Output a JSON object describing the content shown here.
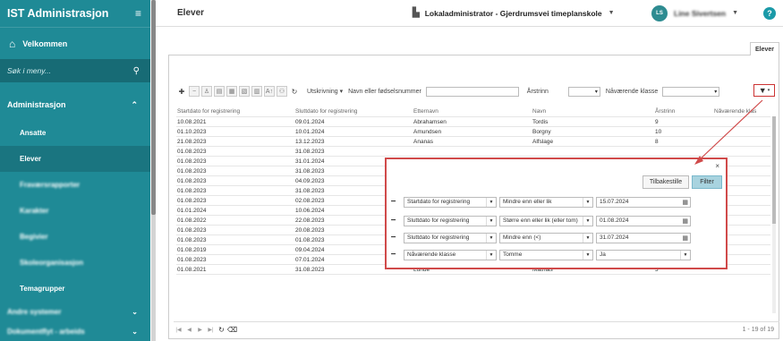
{
  "sidebar": {
    "app_title": "IST Administrasjon",
    "menu_toggle": "≡",
    "home_label": "Velkommen",
    "search_placeholder": "Søk i meny...",
    "section_label": "Administrasjon",
    "items": [
      {
        "label": "Ansatte",
        "active": false,
        "blurred": false
      },
      {
        "label": "Elever",
        "active": true,
        "blurred": false
      },
      {
        "label": "Fraværsrapporter",
        "active": false,
        "blurred": true
      },
      {
        "label": "Karakter",
        "active": false,
        "blurred": true
      },
      {
        "label": "Begivier",
        "active": false,
        "blurred": true
      },
      {
        "label": "Skoleorganisasjon",
        "active": false,
        "blurred": true
      },
      {
        "label": "Temagrupper",
        "active": false,
        "blurred": false
      }
    ],
    "bottom_items": [
      "Andre systemer",
      "Dokumentflyt - arbeids"
    ]
  },
  "topbar": {
    "page_title": "Elever",
    "org_label": "Lokaladministrator - Gjerdrumsvei timeplanskole",
    "user_initials": "LS",
    "user_name": "Line Sivertsen",
    "help_label": "?"
  },
  "tab_label": "Elever",
  "toolbar": {
    "utskrivning_label": "Utskrivning",
    "name_label": "Navn eller fødselsnummer",
    "year_label": "Årstrinn",
    "class_label": "Nåværende klasse"
  },
  "grid": {
    "columns": [
      "Startdato for registrering",
      "Sluttdato for registrering",
      "Etternavn",
      "Navn",
      "Årstrinn",
      "Nåværende klas"
    ],
    "rows": [
      [
        "10.08.2021",
        "09.01.2024",
        "Abrahamsen",
        "Tordis",
        "9",
        ""
      ],
      [
        "01.10.2023",
        "10.01.2024",
        "Amundsen",
        "Borgny",
        "10",
        ""
      ],
      [
        "21.08.2023",
        "13.12.2023",
        "Ananas",
        "Alfslage",
        "8",
        ""
      ],
      [
        "01.08.2023",
        "31.08.2023",
        "",
        "",
        "",
        ""
      ],
      [
        "01.08.2023",
        "31.01.2024",
        "",
        "",
        "",
        ""
      ],
      [
        "01.08.2023",
        "31.08.2023",
        "",
        "",
        "",
        ""
      ],
      [
        "01.08.2023",
        "04.09.2023",
        "",
        "",
        "",
        ""
      ],
      [
        "01.08.2023",
        "31.08.2023",
        "",
        "",
        "",
        ""
      ],
      [
        "01.08.2023",
        "02.08.2023",
        "",
        "",
        "",
        ""
      ],
      [
        "01.01.2024",
        "10.06.2024",
        "",
        "",
        "",
        ""
      ],
      [
        "01.08.2022",
        "22.08.2023",
        "",
        "",
        "",
        ""
      ],
      [
        "01.08.2023",
        "20.08.2023",
        "",
        "",
        "",
        ""
      ],
      [
        "01.08.2023",
        "01.08.2023",
        "Gebonsag",
        "Snadig",
        "7",
        ""
      ],
      [
        "01.08.2019",
        "09.04.2024",
        "Jensen",
        "Alfhild",
        "5",
        ""
      ],
      [
        "01.08.2023",
        "07.01.2024",
        "Korsvoll",
        "Marius",
        "10",
        ""
      ],
      [
        "01.08.2021",
        "31.08.2023",
        "Lunde",
        "Mathias",
        "3",
        ""
      ]
    ]
  },
  "footer": {
    "page_info": "1 - 19 of 19"
  },
  "filter_dialog": {
    "close_label": "×",
    "reset_label": "Tilbakestille",
    "filter_label": "Filter",
    "rows": [
      {
        "field": "Startdato for registrering",
        "operator": "Mindre enn eller lik",
        "value": "15.07.2024",
        "kind": "date"
      },
      {
        "field": "Sluttdato for registrering",
        "operator": "Større enn eller lik (eller tom)",
        "value": "01.08.2024",
        "kind": "date"
      },
      {
        "field": "Sluttdato for registrering",
        "operator": "Mindre enn (<)",
        "value": "31.07.2024",
        "kind": "date"
      },
      {
        "field": "Nåværende klasse",
        "operator": "Tomme",
        "value": "Ja",
        "kind": "select"
      }
    ]
  },
  "colors": {
    "sidebar_bg": "#1f8a96",
    "sidebar_active": "#1a7580",
    "highlight_red": "#d04a4a",
    "filter_button_bg": "#a8d3df"
  }
}
